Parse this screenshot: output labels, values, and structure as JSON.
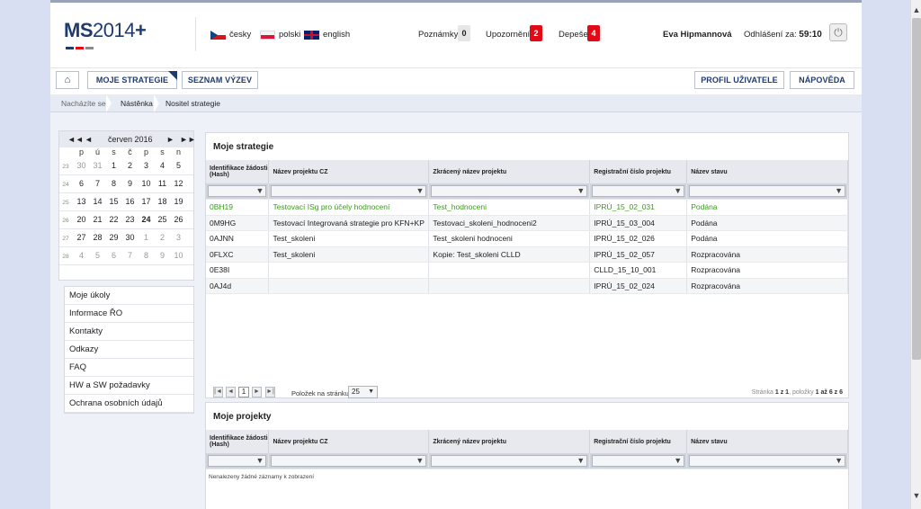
{
  "header": {
    "logo_prefix": "MS",
    "logo_year": "2014",
    "logo_plus": "+",
    "logo_colors": [
      "#1f3b6e",
      "#e20a16",
      "#8a8a8a"
    ],
    "languages": [
      {
        "label": "česky",
        "icon": "czech-flag-icon"
      },
      {
        "label": "polski",
        "icon": "polish-flag-icon"
      },
      {
        "label": "english",
        "icon": "uk-flag-icon"
      }
    ],
    "notes_label": "Poznámky",
    "notes_count": "0",
    "alerts_label": "Upozornění",
    "alerts_count": "2",
    "messages_label": "Depeše",
    "messages_count": "4",
    "user_name": "Eva Hipmannová",
    "logout_label": "Odhlášení za:",
    "logout_time": "59:10",
    "power_icon": "power-icon"
  },
  "nav": {
    "home_icon": "home-icon",
    "my_strategies": "MOJE STRATEGIE",
    "calls_list": "SEZNAM VÝZEV",
    "user_profile": "PROFIL UŽIVATELE",
    "help": "NÁPOVĚDA"
  },
  "breadcrumb": {
    "prefix": "Nacházíte se:",
    "items": [
      "Nástěnka",
      "Nositel strategie"
    ]
  },
  "calendar": {
    "month": "červen 2016",
    "nav": [
      "◄◄",
      "◄",
      "►",
      "►►"
    ],
    "weekdays": [
      "p",
      "ú",
      "s",
      "č",
      "p",
      "s",
      "n"
    ],
    "weeks": [
      {
        "wk": "23",
        "days": [
          "30",
          "31",
          "1",
          "2",
          "3",
          "4",
          "5"
        ]
      },
      {
        "wk": "24",
        "days": [
          "6",
          "7",
          "8",
          "9",
          "10",
          "11",
          "12"
        ]
      },
      {
        "wk": "25",
        "days": [
          "13",
          "14",
          "15",
          "16",
          "17",
          "18",
          "19"
        ]
      },
      {
        "wk": "26",
        "days": [
          "20",
          "21",
          "22",
          "23",
          "24",
          "25",
          "26"
        ]
      },
      {
        "wk": "27",
        "days": [
          "27",
          "28",
          "29",
          "30",
          "1",
          "2",
          "3"
        ]
      },
      {
        "wk": "28",
        "days": [
          "4",
          "5",
          "6",
          "7",
          "8",
          "9",
          "10"
        ]
      }
    ]
  },
  "sidemenu": [
    "Moje úkoly",
    "Informace ŘO",
    "Kontakty",
    "Odkazy",
    "FAQ",
    "HW a SW požadavky",
    "Ochrana osobních údajů"
  ],
  "strategies": {
    "title": "Moje strategie",
    "columns": [
      "Identifikace žádosti (Hash)",
      "Název projektu CZ",
      "Zkrácený název projektu",
      "Registrační číslo projektu",
      "Název stavu"
    ],
    "rows": [
      [
        "0BH19",
        "Testovací ISg pro účely hodnocení",
        "Test_hodnoceni",
        "IPRÚ_15_02_031",
        "Podána"
      ],
      [
        "0M9HG",
        "Testovací Integrovaná strategie pro KFN+KP",
        "Testovaci_skoleni_hodnoceni2",
        "IPRÚ_15_03_004",
        "Podána"
      ],
      [
        "0AJNN",
        "Test_skoleni",
        "Test_skoleni hodnoceni",
        "IPRÚ_15_02_026",
        "Podána"
      ],
      [
        "0FLXC",
        "Test_skoleni",
        "Kopie: Test_skoleni CLLD",
        "IPRÚ_15_02_057",
        "Rozpracována"
      ],
      [
        "0E38I",
        "",
        "",
        "CLLD_15_10_001",
        "Rozpracována"
      ],
      [
        "0AJ4d",
        "",
        "",
        "IPRÚ_15_02_024",
        "Rozpracována"
      ]
    ],
    "pager": {
      "page": "1",
      "per_page_label": "Položek na stránku",
      "per_page": "25",
      "info_prefix": "Stránka",
      "info_page": "1 z 1",
      "info_mid": ", položky",
      "info_range": "1 až 6 z 6"
    }
  },
  "projects": {
    "title": "Moje projekty",
    "columns": [
      "Identifikace žádosti (Hash)",
      "Název projektu CZ",
      "Zkrácený název projektu",
      "Registrační číslo projektu",
      "Název stavu"
    ],
    "empty": "Nenalezeny žádné záznamy k zobrazení"
  }
}
